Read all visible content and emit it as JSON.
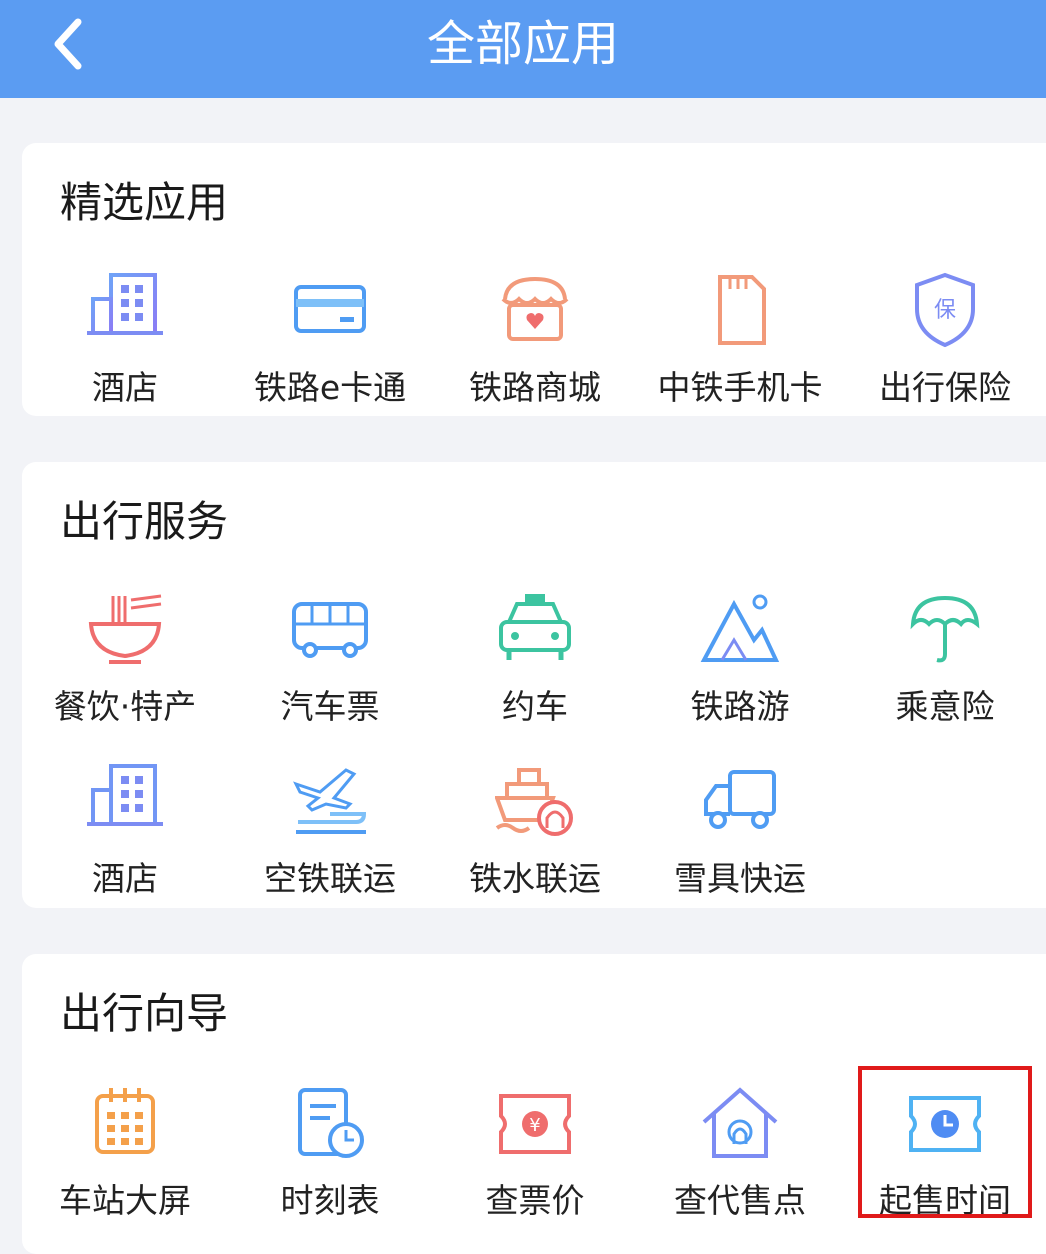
{
  "header": {
    "title": "全部应用",
    "back_icon": "chevron-left-icon"
  },
  "sections": [
    {
      "title": "精选应用",
      "items": [
        {
          "label": "酒店",
          "icon": "building-icon"
        },
        {
          "label": "铁路e卡通",
          "icon": "card-icon"
        },
        {
          "label": "铁路商城",
          "icon": "store-icon"
        },
        {
          "label": "中铁手机卡",
          "icon": "sim-card-icon"
        },
        {
          "label": "出行保险",
          "icon": "shield-icon"
        }
      ]
    },
    {
      "title": "出行服务",
      "items": [
        {
          "label": "餐饮·特产",
          "icon": "noodle-bowl-icon"
        },
        {
          "label": "汽车票",
          "icon": "bus-icon"
        },
        {
          "label": "约车",
          "icon": "taxi-icon"
        },
        {
          "label": "铁路游",
          "icon": "mountain-icon"
        },
        {
          "label": "乘意险",
          "icon": "umbrella-icon"
        },
        {
          "label": "酒店",
          "icon": "building-icon"
        },
        {
          "label": "空铁联运",
          "icon": "plane-train-icon"
        },
        {
          "label": "铁水联运",
          "icon": "ship-icon"
        },
        {
          "label": "雪具快运",
          "icon": "truck-icon"
        }
      ]
    },
    {
      "title": "出行向导",
      "items": [
        {
          "label": "车站大屏",
          "icon": "calendar-icon"
        },
        {
          "label": "时刻表",
          "icon": "timetable-icon"
        },
        {
          "label": "查票价",
          "icon": "ticket-price-icon"
        },
        {
          "label": "查代售点",
          "icon": "house-icon"
        },
        {
          "label": "起售时间",
          "icon": "ticket-clock-icon",
          "highlighted": true
        }
      ]
    }
  ],
  "colors": {
    "header": "#5b9cf2",
    "highlight_border": "#e01a1a"
  }
}
